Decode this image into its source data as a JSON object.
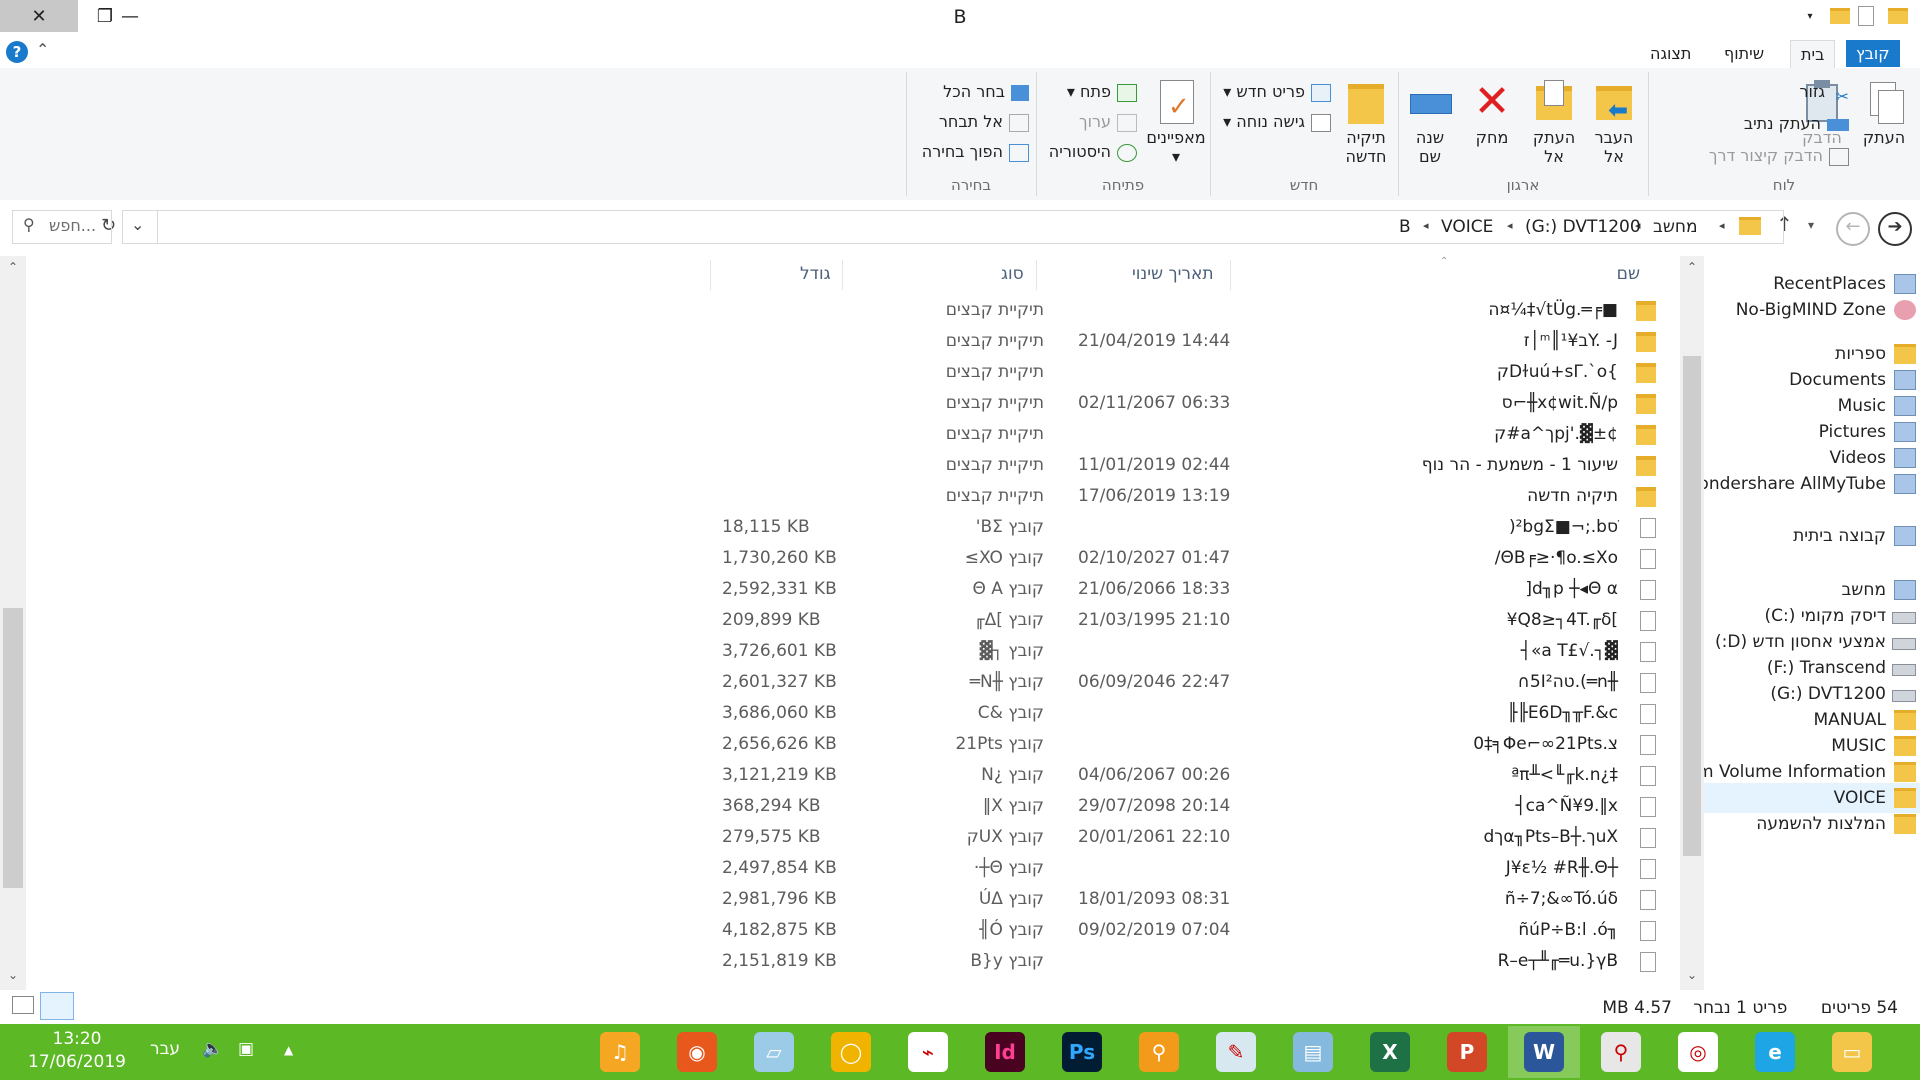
{
  "window": {
    "title": "B",
    "close": "✕",
    "restore": "❐",
    "minimize": "—"
  },
  "ribbon_tabs": [
    "קובץ",
    "בית",
    "שיתוף",
    "תצוגה"
  ],
  "ribbon": {
    "clipboard": {
      "label": "לוח",
      "copy": "העתק",
      "paste": "הדבק",
      "cut": "גזור",
      "copy_path": "העתק נתיב",
      "paste_shortcut": "הדבק קיצור דרך"
    },
    "organize": {
      "label": "ארגון",
      "move_to": [
        "העבר",
        "אל"
      ],
      "copy_to": [
        "העתק",
        "אל"
      ],
      "delete": "מחק",
      "rename": [
        "שנה",
        "שם"
      ]
    },
    "new": {
      "label": "חדש",
      "new_folder": [
        "תיקיה",
        "חדשה"
      ],
      "new_item": "פריט חדש",
      "easy_access": "גישה נוחה"
    },
    "open": {
      "label": "פתיחה",
      "properties": "מאפיינים",
      "open": "פתח",
      "edit": "ערוך",
      "history": "היסטוריה"
    },
    "select": {
      "label": "בחירה",
      "select_all": "בחר הכל",
      "select_none": "אל תבחר",
      "invert": "הפוך בחירה"
    }
  },
  "address": {
    "crumbs": [
      "מחשב",
      "(G:) DVT1200",
      "VOICE",
      "B"
    ],
    "search_placeholder": "חפש..."
  },
  "columns": {
    "name": "שם",
    "date": "תאריך שינוי",
    "type": "סוג",
    "size": "גודל"
  },
  "rows": [
    {
      "name": "ה¤¼‡√tÜg.═╒■",
      "date": "",
      "type": "תיקיית קבצים",
      "size": "",
      "folder": true
    },
    {
      "name": "ז│ᵐ║¹¥בY. -J",
      "date": "21/04/2019 14:44",
      "type": "תיקיית קבצים",
      "size": "",
      "folder": true
    },
    {
      "name": "קDɫuú+sΓ.`o{",
      "date": "",
      "type": "תיקיית קבצים",
      "size": "",
      "folder": true
    },
    {
      "name": "ס⌐╫x¢wit.Ñ/p",
      "date": "02/11/2067 06:33",
      "type": "תיקיית קבצים",
      "size": "",
      "folder": true
    },
    {
      "name": "ק#a^ךpj'.▓±¢",
      "date": "",
      "type": "תיקיית קבצים",
      "size": "",
      "folder": true
    },
    {
      "name": "שיעור 1 - משמעת - הר נוף",
      "date": "11/01/2019 02:44",
      "type": "תיקיית קבצים",
      "size": "",
      "folder": true
    },
    {
      "name": "תיקיה חדשה",
      "date": "17/06/2019 13:19",
      "type": "תיקיית קבצים",
      "size": "",
      "folder": true
    },
    {
      "name": ")²bgΣ■¬;.bסׁ",
      "date": "",
      "type": "קובץ BΣ'",
      "size": "18,115 KB",
      "folder": false
    },
    {
      "name": "/ΘB╒≥·¶o.≤Xo",
      "date": "02/10/2027 01:47",
      "type": "קובץ XO≥",
      "size": "1,730,260 KB",
      "folder": false
    },
    {
      "name": "]d╖p ┼◂Θ α",
      "date": "21/06/2066 18:33",
      "type": "קובץ Θ A",
      "size": "2,592,331 KB",
      "folder": false
    },
    {
      "name": "¥Q8≥┐4T.╓δ[",
      "date": "21/03/1995 21:10",
      "type": "קובץ ]Δ╓",
      "size": "209,899 KB",
      "folder": false
    },
    {
      "name": "┤«a T£√.┐▓",
      "date": "",
      "type": "קובץ ┐▓",
      "size": "3,726,601 KB",
      "folder": false
    },
    {
      "name": "∩5I²טה.(═n╫",
      "date": "06/09/2046 22:47",
      "type": "קובץ ╫N═",
      "size": "2,601,327 KB",
      "folder": false
    },
    {
      "name": "╟╟E6D╖╥F.&c",
      "date": "",
      "type": "קובץ &C",
      "size": "3,686,060 KB",
      "folder": false
    },
    {
      "name": "0‡╕Φe⌐∞21Pts.צ",
      "date": "",
      "type": "קובץ 21Pts",
      "size": "2,656,626 KB",
      "folder": false
    },
    {
      "name": "ªπ╨<╙╓k.n¿‡",
      "date": "04/06/2067 00:26",
      "type": "קובץ ¿N",
      "size": "3,121,219 KB",
      "folder": false
    },
    {
      "name": "┤ca^Ñ¥9.‖x",
      "date": "29/07/2098 20:14",
      "type": "קובץ X‖",
      "size": "368,294 KB",
      "folder": false
    },
    {
      "name": "dךα╖Pts–B┼.ךuX",
      "date": "20/01/2061 22:10",
      "type": "קובץ UXק",
      "size": "279,575 KB",
      "folder": false
    },
    {
      "name": "J¥ε½ #R╫.Θ┼",
      "date": "",
      "type": "קובץ Θ┼·",
      "size": "2,497,854 KB",
      "folder": false
    },
    {
      "name": "ñ÷7;&∞Tó.úδ",
      "date": "18/01/2093 08:31",
      "type": "קובץ ÚΔ",
      "size": "2,981,796 KB",
      "folder": false
    },
    {
      "name": "ñúP÷B:l .ó╖",
      "date": "09/02/2019 07:04",
      "type": "קובץ Ó╢",
      "size": "4,182,875 KB",
      "folder": false
    },
    {
      "name": "R–e┬╨╓═u.}γB",
      "date": "",
      "type": "קובץ B}y",
      "size": "2,151,819 KB",
      "folder": false
    }
  ],
  "nav": [
    {
      "label": "RecentPlaces",
      "kind": "recent-icon"
    },
    {
      "label": "No-BigMIND Zone",
      "kind": "zone-icon"
    },
    {
      "label": "ספריות",
      "kind": "library-icon"
    },
    {
      "label": "Documents",
      "kind": "documents-icon"
    },
    {
      "label": "Music",
      "kind": "music-icon"
    },
    {
      "label": "Pictures",
      "kind": "pictures-icon"
    },
    {
      "label": "Videos",
      "kind": "videos-icon"
    },
    {
      "label": "Wondershare AllMyTube",
      "kind": "allmytube-icon"
    },
    {
      "label": "קבוצה ביתית",
      "kind": "homegroup-icon"
    },
    {
      "label": "מחשב",
      "kind": "computer-icon"
    },
    {
      "label": "(C:) דיסק מקומי",
      "kind": "drive-c-icon"
    },
    {
      "label": "אמצעי אחסון חדש (D:)",
      "kind": "drive-d-icon"
    },
    {
      "label": "(F:) Transcend",
      "kind": "drive-f-icon"
    },
    {
      "label": "(G:) DVT1200",
      "kind": "drive-g-icon"
    },
    {
      "label": "MANUAL",
      "kind": "folder-icon"
    },
    {
      "label": "MUSIC",
      "kind": "folder-icon"
    },
    {
      "label": "System Volume Information",
      "kind": "folder-icon"
    },
    {
      "label": "VOICE",
      "kind": "folder-icon"
    },
    {
      "label": "המלצות להשמעה",
      "kind": "folder-icon"
    }
  ],
  "status": {
    "count": "54 פריטים",
    "selected": "פריט 1 נבחר",
    "size": "4.57 MB"
  },
  "taskbar": {
    "time": "13:20",
    "date": "17/06/2019",
    "lang": "עבר",
    "apps": [
      "audacity-icon",
      "firefox-icon",
      "files-icon",
      "chrome-canary-icon",
      "acrobat-icon",
      "indesign-icon",
      "photoshop-icon",
      "search-tool-icon",
      "paint-icon",
      "notepad-icon",
      "excel-icon",
      "powerpoint-icon",
      "word-icon",
      "magnifier-icon",
      "chrome-icon",
      "ie-icon",
      "explorer-icon"
    ]
  },
  "colors": {
    "accent": "#1979ca",
    "taskbar": "#5cb825"
  }
}
